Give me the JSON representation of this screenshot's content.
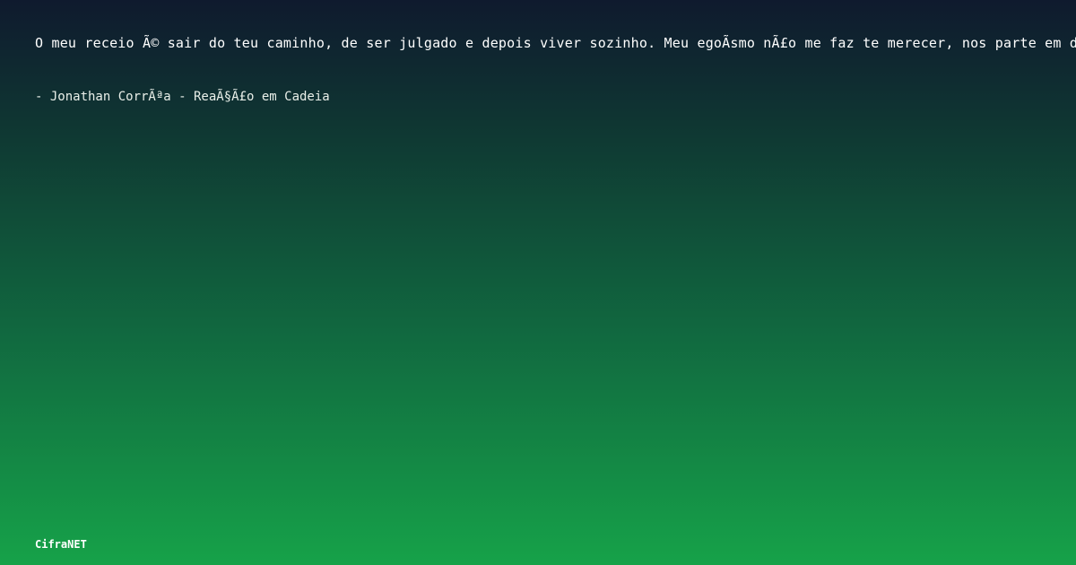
{
  "quote": {
    "text": "O meu receio Ã© sair do teu caminho, de ser julgado e depois viver sozinho. Meu egoÃ­smo nÃ£o me faz te merecer, nos parte em dois"
  },
  "attribution": {
    "text": "- Jonathan CorrÃªa - ReaÃ§Ã£o em Cadeia"
  },
  "brand": {
    "name": "CifraNET"
  },
  "colors": {
    "background_top": "#0f1a2e",
    "background_bottom": "#16a249",
    "text": "#ffffff"
  }
}
